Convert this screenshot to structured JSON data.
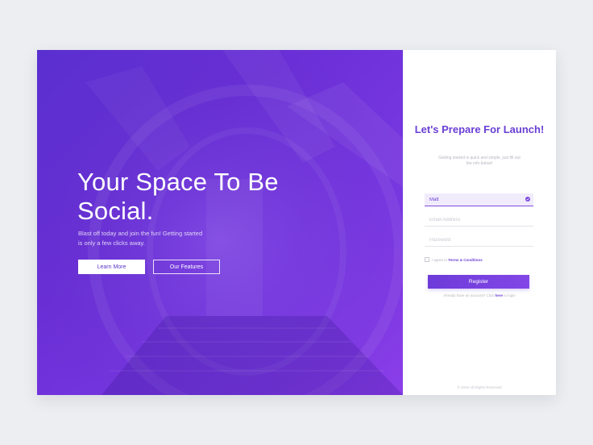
{
  "hero": {
    "title": "Your Space To Be Social.",
    "subtitle": "Blast off today and join the fun! Getting started is only a few clicks away.",
    "learn_more_label": "Learn More",
    "features_label": "Our Features"
  },
  "form": {
    "title": "Let's Prepare For Launch!",
    "subtitle": "Getting started is quick and simple, just fill out the info below!",
    "name_value": "Matt",
    "email_placeholder": "Email Address",
    "password_placeholder": "Password",
    "terms_prefix": "I agree to",
    "terms_link": "Terms & Conditions",
    "register_label": "Register",
    "login_prefix": "Already have an account? Click",
    "login_link": "here",
    "login_suffix": "to login"
  },
  "footer": {
    "copyright": "© 2016 All Rights Reserved"
  },
  "colors": {
    "accent": "#6a3fd4",
    "hero_gradient_start": "#5a2fcf",
    "hero_gradient_end": "#8a3ee8"
  },
  "icons": {
    "name_valid": "check-circle-icon",
    "terms_checkbox": "checkbox-icon"
  }
}
